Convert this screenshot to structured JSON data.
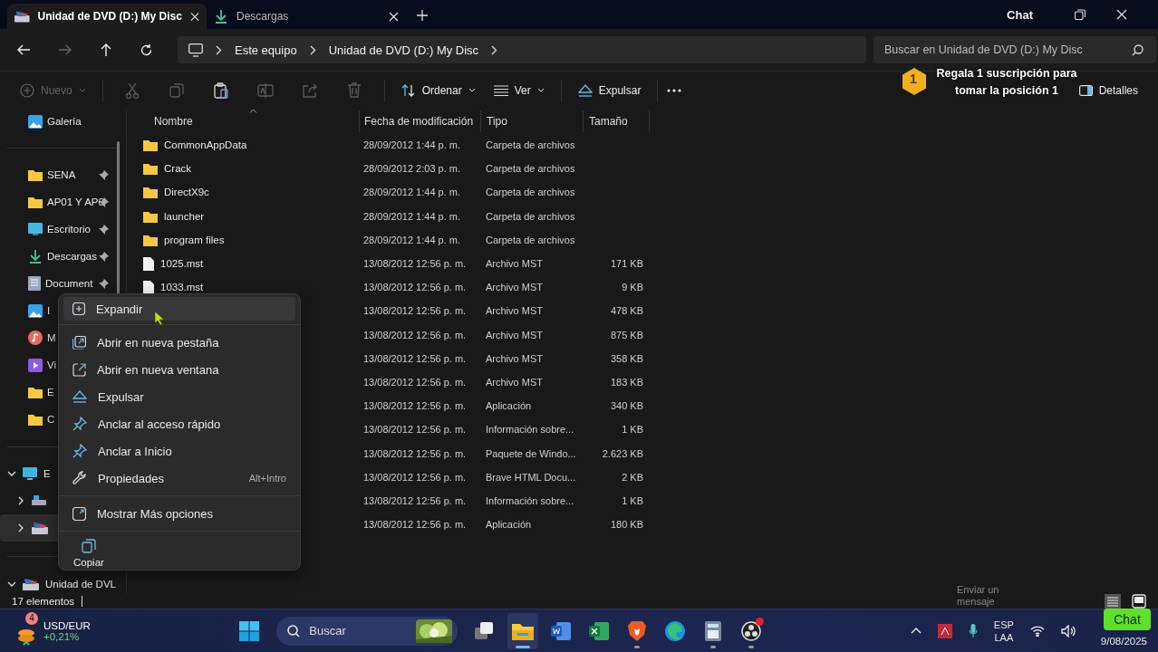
{
  "tabs": [
    {
      "title": "Unidad de DVD (D:) My Disc",
      "kind": "disc",
      "selected": true
    },
    {
      "title": "Descargas",
      "kind": "download",
      "selected": false
    }
  ],
  "stream_overlay": {
    "chat_label": "Chat",
    "gift_badge": "1",
    "gift_text": "Regala 1 suscripción para tomar la posición 1",
    "message_hint": "Enviar un mensaje",
    "chat_button": "Chat"
  },
  "breadcrumb": [
    "Este equipo",
    "Unidad de DVD (D:) My Disc"
  ],
  "search": {
    "placeholder": "Buscar en Unidad de DVD (D:) My Disc"
  },
  "toolbar": {
    "new_label": "Nuevo",
    "sort_label": "Ordenar",
    "view_label": "Ver",
    "eject_label": "Expulsar",
    "details_label": "Detalles",
    "actions": [
      {
        "kind": "cut",
        "disabled": true
      },
      {
        "kind": "copy",
        "disabled": true
      },
      {
        "kind": "paste",
        "disabled": false
      },
      {
        "kind": "rename",
        "disabled": true
      },
      {
        "kind": "share",
        "disabled": true
      },
      {
        "kind": "delete",
        "disabled": true
      }
    ]
  },
  "sidebar": {
    "top": {
      "label": "Galería",
      "kind": "gallery"
    },
    "quick_access": [
      {
        "label": "SENA",
        "kind": "folder",
        "pinned": true
      },
      {
        "label": "AP01 Y AP0",
        "kind": "folder",
        "pinned": true
      },
      {
        "label": "Escritorio",
        "kind": "desktop",
        "pinned": true
      },
      {
        "label": "Descargas",
        "kind": "download",
        "pinned": true
      },
      {
        "label": "Document",
        "kind": "document",
        "pinned": true
      },
      {
        "label": "I",
        "kind": "pictures"
      },
      {
        "label": "M",
        "kind": "music"
      },
      {
        "label": "Vi",
        "kind": "video"
      },
      {
        "label": "E",
        "kind": "folder"
      },
      {
        "label": "C",
        "kind": "folder"
      }
    ],
    "tree": [
      {
        "label": "E",
        "kind": "pc",
        "expanded": true,
        "selected": false,
        "children": [
          {
            "kind": "drive",
            "expanded": false,
            "selected": false
          },
          {
            "kind": "dvd",
            "expanded": false,
            "selected": true
          }
        ]
      },
      {
        "label": "Unidad de DVL",
        "kind": "dvd",
        "expanded": true,
        "selected": false
      }
    ]
  },
  "table": {
    "columns": [
      "Nombre",
      "Fecha de modificación",
      "Tipo",
      "Tamaño"
    ],
    "rows": [
      {
        "name": "CommonAppData",
        "kind": "folder",
        "date": "28/09/2012 1:44 p. m.",
        "type": "Carpeta de archivos"
      },
      {
        "name": "Crack",
        "kind": "folder",
        "date": "28/09/2012 2:03 p. m.",
        "type": "Carpeta de archivos"
      },
      {
        "name": "DirectX9c",
        "kind": "folder",
        "date": "28/09/2012 1:44 p. m.",
        "type": "Carpeta de archivos"
      },
      {
        "name": "launcher",
        "kind": "folder",
        "date": "28/09/2012 1:44 p. m.",
        "type": "Carpeta de archivos"
      },
      {
        "name": "program files",
        "kind": "folder",
        "date": "28/09/2012 1:44 p. m.",
        "type": "Carpeta de archivos"
      },
      {
        "name": "1025.mst",
        "kind": "file",
        "date": "13/08/2012 12:56 p. m.",
        "type": "Archivo MST",
        "size": "171 KB"
      },
      {
        "name": "1033.mst",
        "kind": "file",
        "date": "13/08/2012 12:56 p. m.",
        "type": "Archivo MST",
        "size": "9 KB"
      },
      {
        "date": "13/08/2012 12:56 p. m.",
        "type": "Archivo MST",
        "size": "478 KB"
      },
      {
        "date": "13/08/2012 12:56 p. m.",
        "type": "Archivo MST",
        "size": "875 KB"
      },
      {
        "date": "13/08/2012 12:56 p. m.",
        "type": "Archivo MST",
        "size": "358 KB"
      },
      {
        "date": "13/08/2012 12:56 p. m.",
        "type": "Archivo MST",
        "size": "183 KB"
      },
      {
        "date": "13/08/2012 12:56 p. m.",
        "type": "Aplicación",
        "size": "340 KB"
      },
      {
        "date": "13/08/2012 12:56 p. m.",
        "type": "Información sobre...",
        "size": "1 KB"
      },
      {
        "date": "13/08/2012 12:56 p. m.",
        "type": "Paquete de Windo...",
        "size": "2.623 KB"
      },
      {
        "date": "13/08/2012 12:56 p. m.",
        "type": "Brave HTML Docu...",
        "size": "2 KB"
      },
      {
        "date": "13/08/2012 12:56 p. m.",
        "type": "Información sobre...",
        "size": "1 KB"
      },
      {
        "date": "13/08/2012 12:56 p. m.",
        "type": "Aplicación",
        "size": "180 KB"
      }
    ]
  },
  "context_menu": {
    "groups": [
      [
        {
          "label": "Expandir",
          "kind": "expand",
          "selected": true
        }
      ],
      [
        {
          "label": "Abrir en nueva pestaña",
          "kind": "newtab",
          "selected": false
        },
        {
          "label": "Abrir en nueva ventana",
          "kind": "newwindow",
          "selected": false
        },
        {
          "label": "Expulsar",
          "kind": "eject",
          "selected": false
        },
        {
          "label": "Anclar al acceso rápido",
          "kind": "pin",
          "selected": false
        },
        {
          "label": "Anclar a Inicio",
          "kind": "pin",
          "selected": false
        },
        {
          "label": "Propiedades",
          "kind": "wrench",
          "shortcut": "Alt+Intro",
          "selected": false
        }
      ],
      [
        {
          "label": "Mostrar Más opciones",
          "kind": "more",
          "selected": false
        }
      ]
    ],
    "bottom_action": {
      "label": "Copiar",
      "kind": "copy"
    }
  },
  "status_bar": {
    "count": "17 elementos"
  },
  "taskbar": {
    "widget": {
      "badge": "4",
      "title": "USD/EUR",
      "change": "+0,21%"
    },
    "search_placeholder": "Buscar",
    "apps": [
      {
        "kind": "start",
        "running": false,
        "active": false
      },
      {
        "kind": "taskview",
        "running": false,
        "active": false
      },
      {
        "kind": "explorer",
        "running": true,
        "active": true
      },
      {
        "kind": "word",
        "running": false,
        "active": false
      },
      {
        "kind": "excel",
        "running": false,
        "active": false
      },
      {
        "kind": "brave",
        "running": true,
        "active": false
      },
      {
        "kind": "edge",
        "running": false,
        "active": false
      },
      {
        "kind": "calculator",
        "running": true,
        "active": false
      },
      {
        "kind": "obs",
        "running": true,
        "active": false
      }
    ],
    "language": [
      "ESP",
      "LAA"
    ],
    "date": "9/08/2025"
  }
}
